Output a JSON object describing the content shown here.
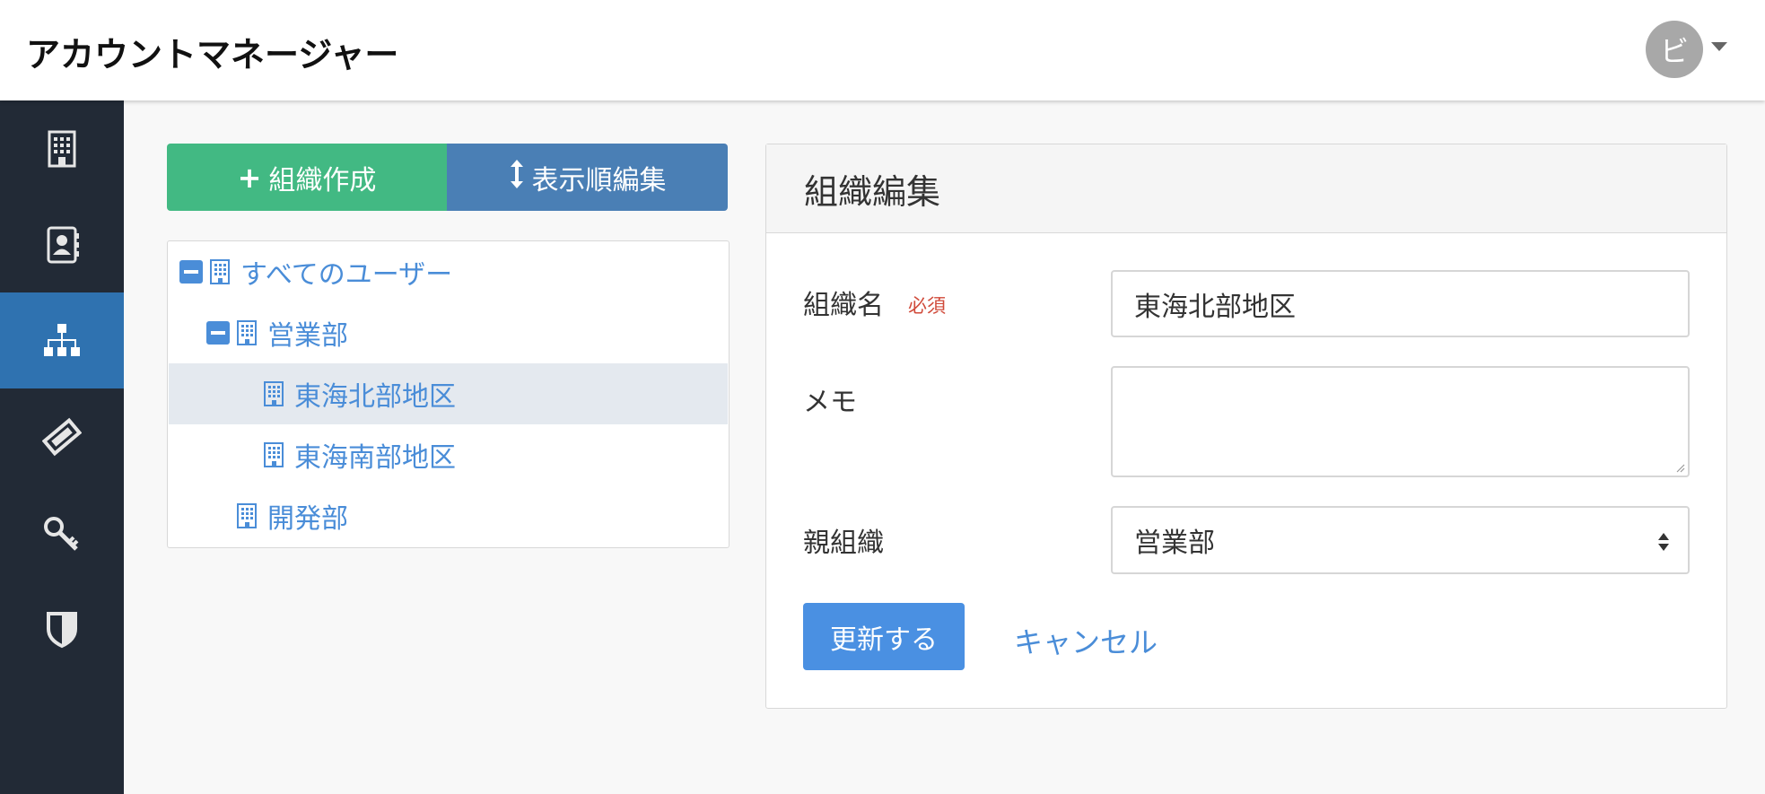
{
  "header": {
    "app_title": "アカウントマネージャー",
    "avatar_initial": "ビ"
  },
  "sidebar": {
    "items": [
      {
        "icon": "building-icon",
        "active": false
      },
      {
        "icon": "contacts-icon",
        "active": false
      },
      {
        "icon": "org-chart-icon",
        "active": true
      },
      {
        "icon": "ticket-icon",
        "active": false
      },
      {
        "icon": "key-icon",
        "active": false
      },
      {
        "icon": "shield-icon",
        "active": false
      }
    ],
    "active_color": "#2f72b0"
  },
  "toolbar": {
    "create_label": "組織作成",
    "order_label": "表示順編集",
    "create_color": "#42b983",
    "order_color": "#4a7fb5"
  },
  "tree": {
    "nodes": [
      {
        "label": "すべてのユーザー",
        "level": 0,
        "expanded": true
      },
      {
        "label": "営業部",
        "level": 1,
        "expanded": true
      },
      {
        "label": "東海北部地区",
        "level": 2,
        "selected": true
      },
      {
        "label": "東海南部地区",
        "level": 2
      },
      {
        "label": "開発部",
        "level": 1
      }
    ]
  },
  "form": {
    "title": "組織編集",
    "name_label": "組織名",
    "required_label": "必須",
    "name_value": "東海北部地区",
    "memo_label": "メモ",
    "memo_value": "",
    "parent_label": "親組織",
    "parent_value": "営業部",
    "update_label": "更新する",
    "cancel_label": "キャンセル"
  }
}
